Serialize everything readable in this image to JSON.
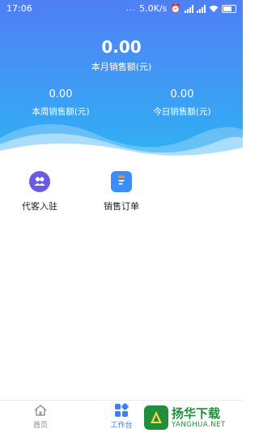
{
  "status_bar": {
    "time": "17:06",
    "signal_dots": "...",
    "net_speed": "5.0K/s"
  },
  "summary": {
    "month_value": "0.00",
    "month_label": "本月销售额(元)",
    "week_value": "0.00",
    "week_label": "本周销售额(元)",
    "today_value": "0.00",
    "today_label": "今日销售额(元)"
  },
  "tiles": [
    {
      "label": "代客入驻",
      "icon": "users-icon"
    },
    {
      "label": "销售订单",
      "icon": "clipboard-icon"
    }
  ],
  "tabbar": {
    "items": [
      {
        "label": "首页",
        "icon": "home-icon",
        "active": false
      },
      {
        "label": "工作台",
        "icon": "grid-icon",
        "active": true
      }
    ]
  },
  "watermark": {
    "cn": "扬华下载",
    "en": "YANGHUA.NET"
  },
  "colors": {
    "accent": "#3b7ff3",
    "hero_top": "#4f7ff6",
    "hero_bottom": "#2fb1f3",
    "tile1_icon": "#6a5be2",
    "tile2_icon": "#3b8ef6",
    "watermark": "#1f8f3a"
  }
}
